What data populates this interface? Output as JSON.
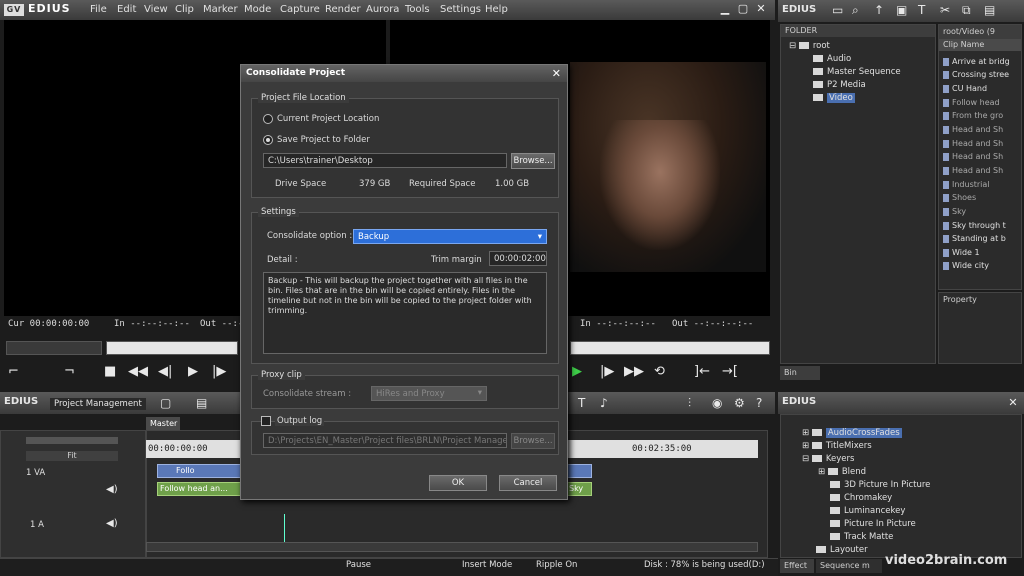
{
  "app": {
    "name": "EDIUS",
    "logo_mark": "GV"
  },
  "menu": [
    "File",
    "Edit",
    "View",
    "Clip",
    "Marker",
    "Mode",
    "Capture",
    "Render",
    "Aurora",
    "Tools",
    "Settings",
    "Help"
  ],
  "player": {
    "cur": "Cur 00:00:00:00",
    "in": "In --:--:--:--",
    "out": "Out --:--:--:--"
  },
  "recorder": {
    "in": "In --:--:--:--",
    "out": "Out --:--:--:--"
  },
  "dialog": {
    "title": "Consolidate Project",
    "location": {
      "group_label": "Project File Location",
      "opt_current": "Current Project Location",
      "opt_save": "Save Project to Folder",
      "path": "C:\\Users\\trainer\\Desktop",
      "browse": "Browse...",
      "drive_space_label": "Drive Space",
      "drive_space_value": "379 GB",
      "required_label": "Required Space",
      "required_value": "1.00 GB"
    },
    "settings": {
      "group_label": "Settings",
      "option_label": "Consolidate option :",
      "option_value": "Backup",
      "detail_label": "Detail :",
      "trim_label": "Trim margin",
      "trim_value": "00:00:02:00",
      "description": "Backup - This will backup the project together with all files in the bin. Files that are in the bin will be copied entirely. Files in the timeline but not in the bin will be copied to the project folder with trimming."
    },
    "proxy": {
      "group_label": "Proxy clip",
      "stream_label": "Consolidate stream :",
      "stream_value": "HiRes and Proxy"
    },
    "output": {
      "label": "Output log",
      "path": "D:\\Projects\\EN_Master\\Project files\\BRLN\\Project Management",
      "browse": "Browse..."
    },
    "ok": "OK",
    "cancel": "Cancel"
  },
  "bin": {
    "title": "EDIUS",
    "path": "root/Video (9",
    "folder_header": "FOLDER",
    "clipname_header": "Clip Name",
    "folders": [
      "root",
      "Audio",
      "Master Sequence",
      "P2 Media",
      "Video"
    ],
    "clips": [
      "Arrive at bridg",
      "Crossing stree",
      "CU Hand",
      "Follow head",
      "From the gro",
      "Head and Sh",
      "Head and Sh",
      "Head and Sh",
      "Head and Sh",
      "Industrial",
      "Shoes",
      "Sky",
      "Sky through t",
      "Standing at b",
      "Wide 1",
      "Wide city"
    ],
    "property": "Property",
    "tab": "Bin"
  },
  "timeline": {
    "title": "EDIUS",
    "project": "Project Management",
    "sequence_tab": "Master",
    "tc_start": "00:00:00:00",
    "tc_end": "00:02:35:00",
    "tracks": {
      "va": "1 VA",
      "a": "1 A",
      "fit": "Fit"
    },
    "clip_label_1": "Follo",
    "clip_label_2": "Follow head an...",
    "clip_label_3": "Sky"
  },
  "effects": {
    "title": "EDIUS",
    "items": [
      "AudioCrossFades",
      "TitleMixers",
      "Keyers",
      "Blend",
      "3D Picture In Picture",
      "Chromakey",
      "Luminancekey",
      "Picture In Picture",
      "Track Matte",
      "Layouter"
    ],
    "tab_effect": "Effect",
    "tab_sequence": "Sequence m"
  },
  "status": {
    "pause": "Pause",
    "insert": "Insert Mode",
    "ripple": "Ripple On",
    "disk": "Disk : 78% is being used(D:)"
  },
  "watermark": "video2brain.com"
}
